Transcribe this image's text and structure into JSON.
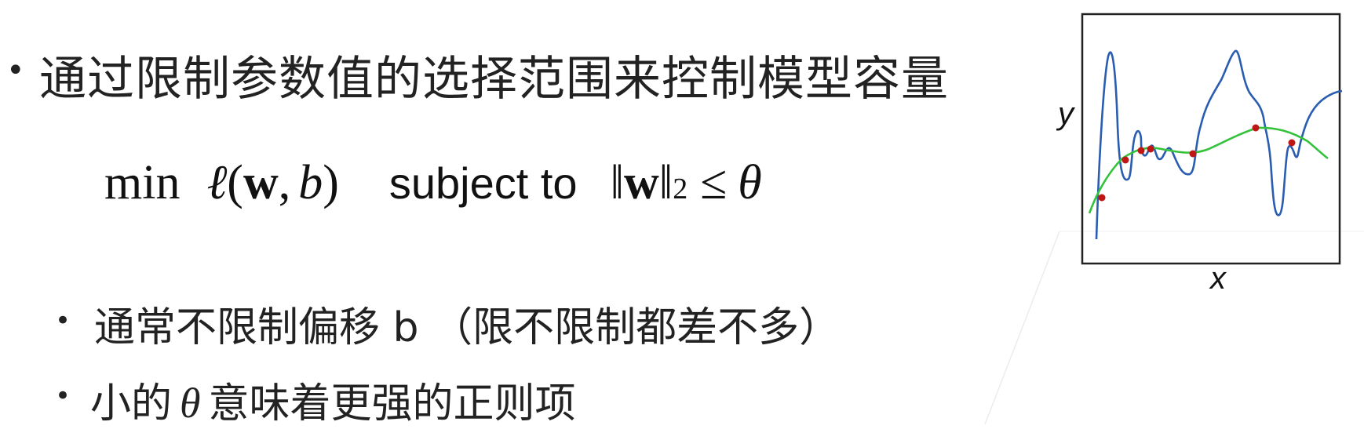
{
  "slide": {
    "main_bullet": "通过限制参数值的选择范围来控制模型容量",
    "formula": {
      "min": "min",
      "loss": "ℓ",
      "open_paren": "(",
      "w": "w",
      "comma": ",",
      "b": "b",
      "close_paren": ")",
      "subject_to": "subject to",
      "norm_open": "‖",
      "norm_close": "‖",
      "exponent": "2",
      "leq": "≤",
      "theta": "θ"
    },
    "sub_bullets": [
      {
        "text": "通常不限制偏移 b （限不限制都差不多）"
      },
      {
        "prefix": "小的",
        "theta": "θ",
        "suffix": "意味着更强的正则项"
      }
    ],
    "bullet_glyph": "•"
  },
  "figure": {
    "x_label": "x",
    "y_label": "y",
    "colors": {
      "overfit_curve": "#2a5db0",
      "regularized_curve": "#33c23a",
      "data_points": "#c01515",
      "frame": "#222222"
    }
  }
}
